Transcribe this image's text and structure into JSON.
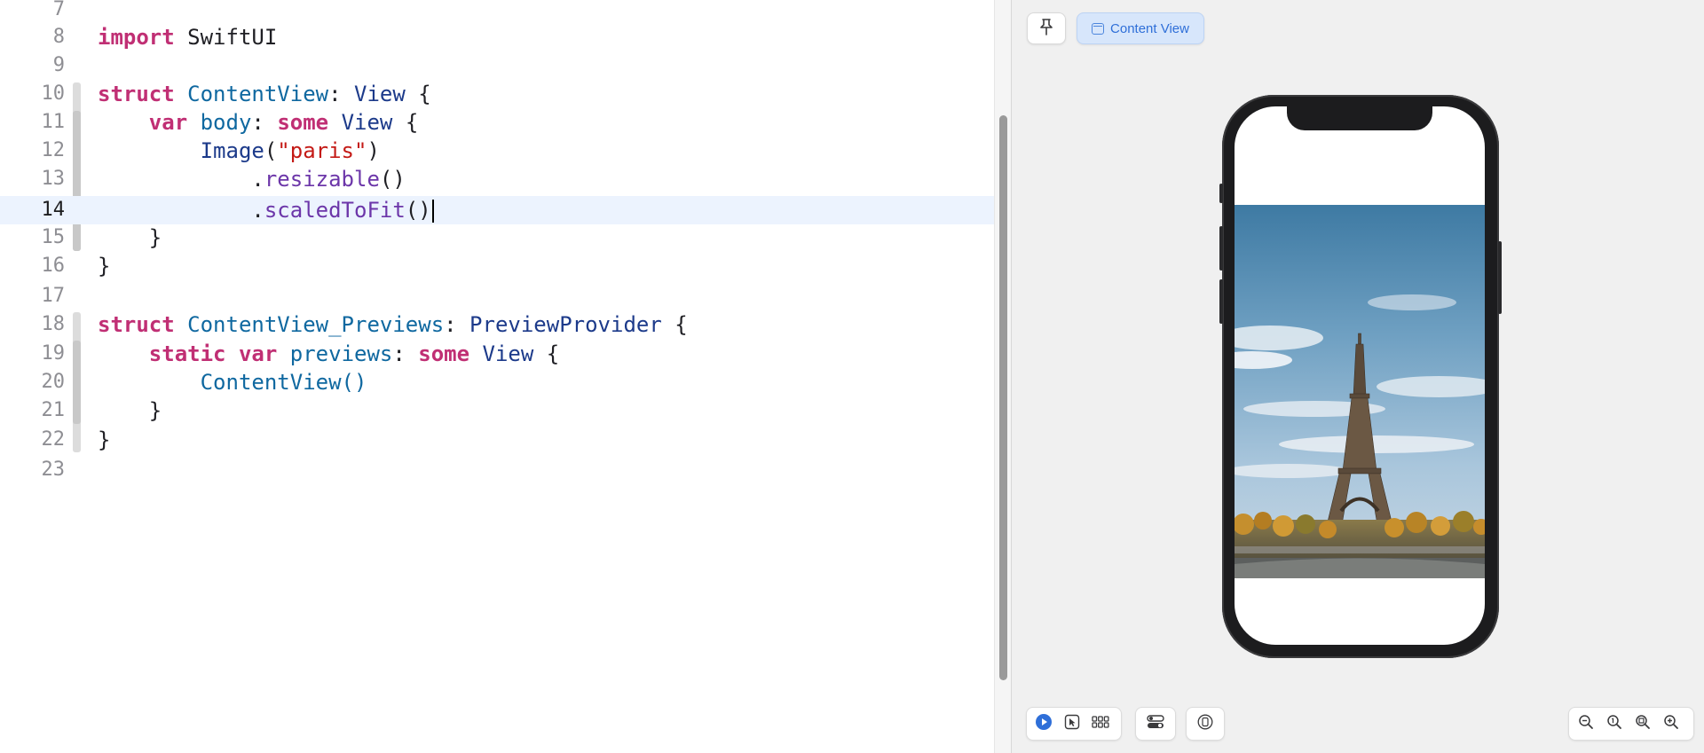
{
  "editor": {
    "current_line": "14",
    "lines": [
      {
        "n": "7"
      },
      {
        "n": "8"
      },
      {
        "n": "9"
      },
      {
        "n": "10"
      },
      {
        "n": "11"
      },
      {
        "n": "12"
      },
      {
        "n": "13"
      },
      {
        "n": "14"
      },
      {
        "n": "15"
      },
      {
        "n": "16"
      },
      {
        "n": "17"
      },
      {
        "n": "18"
      },
      {
        "n": "19"
      },
      {
        "n": "20"
      },
      {
        "n": "21"
      },
      {
        "n": "22"
      },
      {
        "n": "23"
      }
    ],
    "tokens": {
      "import_kw": "import",
      "module": "SwiftUI",
      "struct_kw": "struct",
      "content_view": "ContentView",
      "colon": ":",
      "view_type": "View",
      "open_brace": "{",
      "close_brace": "}",
      "var_kw": "var",
      "body_prop": "body",
      "some_kw": "some",
      "image_type": "Image",
      "paren_open": "(",
      "paren_close": ")",
      "image_name": "\"paris\"",
      "dot": ".",
      "resizable": "resizable",
      "scaled_to_fit": "scaledToFit",
      "empty_parens": "()",
      "previews_struct": "ContentView_Previews",
      "preview_provider": "PreviewProvider",
      "static_kw": "static",
      "previews_prop": "previews",
      "content_view_call": "ContentView()"
    }
  },
  "preview": {
    "canvas_label": "Content View",
    "background": "#f0f0f0",
    "accent": "#2f6fd8",
    "image_alt": "Eiffel Tower, Paris"
  },
  "icons": {
    "pin": "pin-icon",
    "window": "window-icon",
    "live": "play-circle-icon",
    "selectable": "cursor-select-icon",
    "variants": "grid-variants-icon",
    "settings": "device-settings-icon",
    "device": "device-icon",
    "zoom_out": "zoom-out-icon",
    "zoom_100": "zoom-100-icon",
    "zoom_fit": "zoom-fit-icon",
    "zoom_in": "zoom-in-icon"
  }
}
